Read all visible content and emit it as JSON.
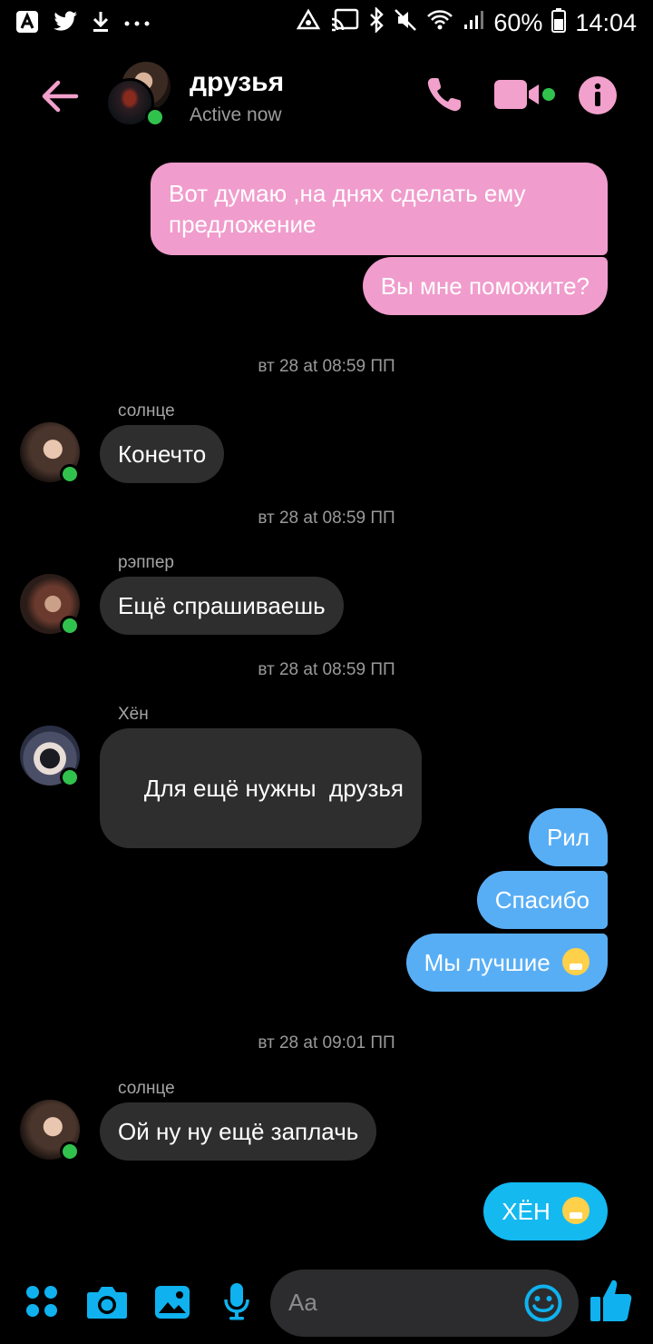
{
  "status_bar": {
    "battery": "60%",
    "time": "14:04"
  },
  "header": {
    "title": "друзья",
    "status": "Active now"
  },
  "messages": [
    {
      "kind": "out",
      "style": "pink",
      "text": "Вот думаю ,на днях сделать ему предложение"
    },
    {
      "kind": "out",
      "style": "pink",
      "text": "Вы мне поможите?"
    },
    {
      "kind": "timestamp",
      "text": "вт 28 at 08:59 ПП"
    },
    {
      "kind": "in",
      "sender": "солнце",
      "text": "Конечто"
    },
    {
      "kind": "timestamp",
      "text": "вт 28 at 08:59 ПП"
    },
    {
      "kind": "in",
      "sender": "рэппер",
      "text": "Ещё спрашиваешь"
    },
    {
      "kind": "timestamp",
      "text": "вт 28 at 08:59 ПП"
    },
    {
      "kind": "in",
      "sender": "Хён",
      "text": "Для ещё нужны  друзья"
    },
    {
      "kind": "out",
      "style": "blue",
      "text": "Рил"
    },
    {
      "kind": "out",
      "style": "blue",
      "text": "Спасибо"
    },
    {
      "kind": "out",
      "style": "blue",
      "text": "Мы лучшие",
      "emoji": "sneezing-face-emoji"
    },
    {
      "kind": "timestamp",
      "text": "вт 28 at 09:01 ПП"
    },
    {
      "kind": "in",
      "sender": "солнце",
      "text": "Ой ну ну ещё заплачь"
    },
    {
      "kind": "out",
      "style": "cyan",
      "text": "ХЁН",
      "emoji": "face-with-steam-emoji"
    }
  ],
  "composer": {
    "placeholder": "Aa"
  },
  "colors": {
    "accent_pink": "#f2a0cc",
    "accent_blue": "#0fb2ef",
    "online": "#31c24d",
    "background": "#000000"
  }
}
